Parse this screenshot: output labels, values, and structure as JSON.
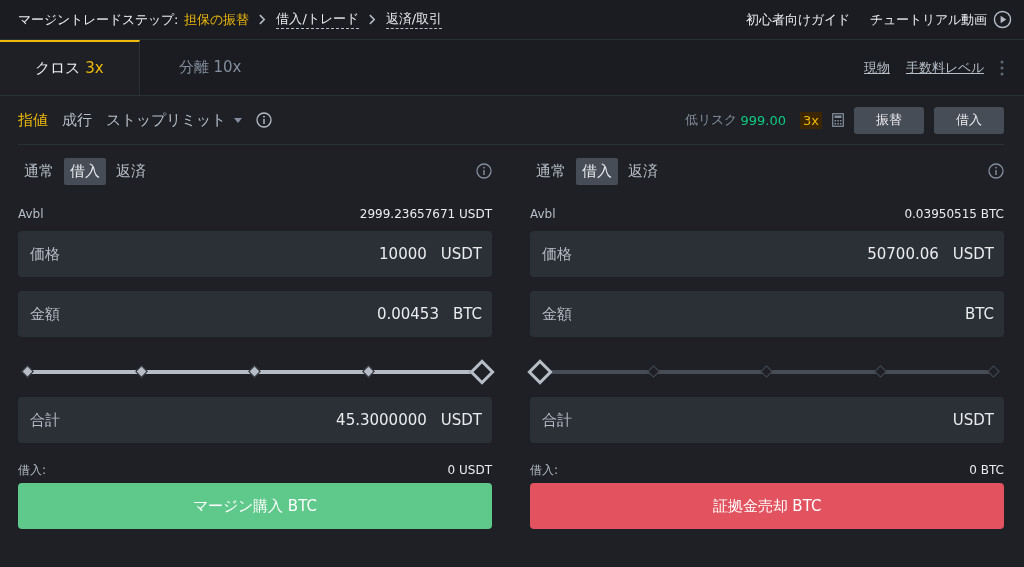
{
  "breadcrumb": {
    "label": "マージントレードステップ:",
    "steps": [
      {
        "text": "担保の振替",
        "selected": true
      },
      {
        "text": "借入/トレード",
        "selected": false
      },
      {
        "text": "返済/取引",
        "selected": false
      }
    ]
  },
  "guides": [
    "初心者向けガイド",
    "チュートリアル動画"
  ],
  "tabs": [
    {
      "label": "クロス",
      "multiplier": "3x",
      "selected": true
    },
    {
      "label": "分離",
      "multiplier": "10x",
      "selected": false
    }
  ],
  "tab_links": [
    "現物",
    "手数料レベル"
  ],
  "order_types": [
    {
      "label": "指値",
      "selected": true,
      "kind": "plain"
    },
    {
      "label": "成行",
      "selected": false,
      "kind": "plain"
    },
    {
      "label": "ストップリミット",
      "selected": false,
      "kind": "dropdown"
    }
  ],
  "risk": {
    "label": "低リスク",
    "value": "999.00",
    "leverage": "3x"
  },
  "actions": [
    "振替",
    "借入"
  ],
  "panels": [
    {
      "modes": [
        {
          "label": "通常",
          "selected": false
        },
        {
          "label": "借入",
          "selected": true
        },
        {
          "label": "返済",
          "selected": false
        }
      ],
      "avbl_label": "Avbl",
      "avbl_value": "2999.23657671 USDT",
      "fields": [
        {
          "label": "価格",
          "value": "10000",
          "unit": "USDT"
        },
        {
          "label": "金額",
          "value": "0.00453",
          "unit": "BTC"
        }
      ],
      "level": 1,
      "total": {
        "label": "合計",
        "value": "45.3000000",
        "unit": "USDT"
      },
      "borrow_label": "借入:",
      "borrow_value": "0 USDT",
      "button": {
        "label": "マージン購入 BTC",
        "kind": "buy"
      }
    },
    {
      "modes": [
        {
          "label": "通常",
          "selected": false
        },
        {
          "label": "借入",
          "selected": true
        },
        {
          "label": "返済",
          "selected": false
        }
      ],
      "avbl_label": "Avbl",
      "avbl_value": "0.03950515 BTC",
      "fields": [
        {
          "label": "価格",
          "value": "50700.06",
          "unit": "USDT"
        },
        {
          "label": "金額",
          "unit": "BTC"
        }
      ],
      "level": 0,
      "total": {
        "label": "合計",
        "unit": "USDT"
      },
      "borrow_label": "借入:",
      "borrow_value": "0 BTC",
      "button": {
        "label": "証拠金売却 BTC",
        "kind": "sell"
      }
    }
  ]
}
